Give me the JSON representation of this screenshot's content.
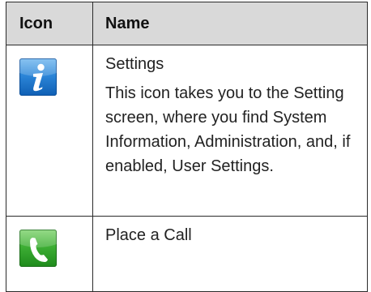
{
  "table": {
    "headers": {
      "icon": "Icon",
      "name": "Name"
    },
    "rows": [
      {
        "icon": "info-icon",
        "title": "Settings",
        "description": "This icon takes you to the Setting screen, where you find System Information, Administration, and, if enabled, User Settings."
      },
      {
        "icon": "phone-icon",
        "title": "Place a Call",
        "description": ""
      }
    ]
  },
  "colors": {
    "header_background": "#d9d9d9",
    "border": "#2a2a2a",
    "info_tile": "#2c86d8",
    "call_tile": "#3eaf35"
  }
}
